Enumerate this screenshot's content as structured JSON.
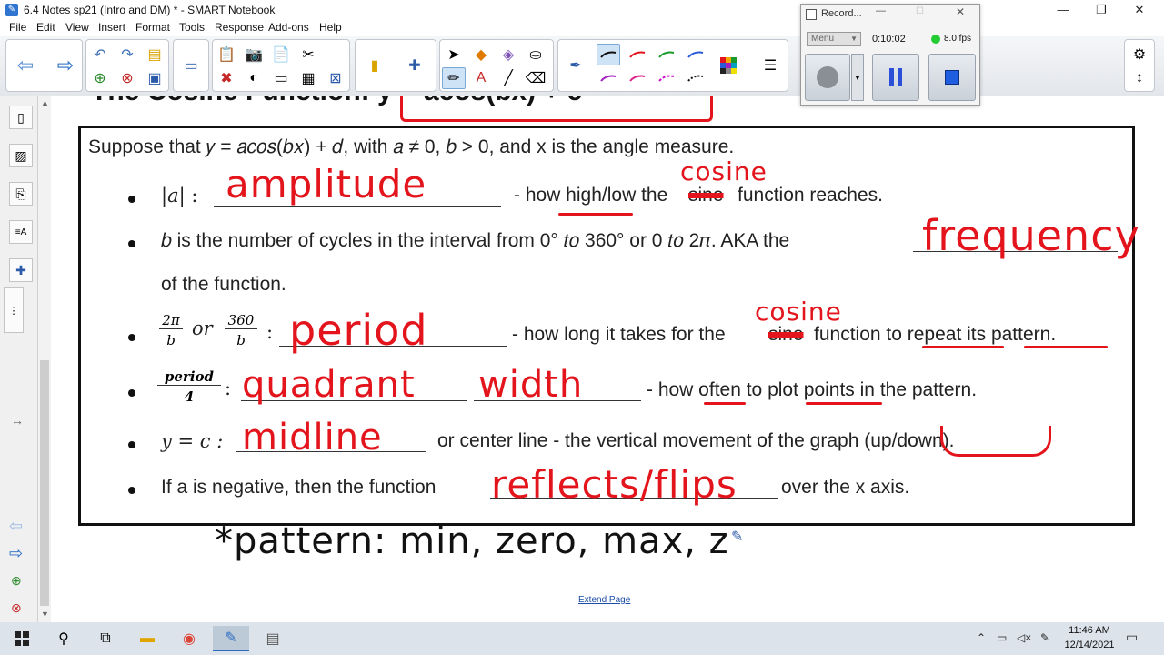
{
  "window": {
    "title": "6.4 Notes sp21 (Intro and DM) * - SMART Notebook",
    "minimize": "—",
    "maximize": "❐",
    "close": "✕"
  },
  "menu": [
    "File",
    "Edit",
    "View",
    "Insert",
    "Format",
    "Tools",
    "Response",
    "Add-ons",
    "Help"
  ],
  "recorder": {
    "title": "Record...",
    "menu_label": "Menu",
    "elapsed": "0:10:02",
    "fps": "8.0 fps"
  },
  "notes": {
    "heading_partial": "The Cosine Function: y = acos(bx) + c",
    "intro": "Suppose that 𝑦 = 𝑎𝑐𝑜𝑠(𝑏𝑥) + 𝑑, with 𝑎 ≠ 0, 𝑏 > 0, and x is the angle measure.",
    "b1_label": "|𝑎| :",
    "b1_text": "- how high/low the",
    "b1_strike": "sine",
    "b1_tail": "function reaches.",
    "b2_text": "𝑏 is the number of cycles in the interval from 0° 𝑡𝑜 360° or 0 𝑡𝑜 2𝜋. AKA the",
    "b2_cont": "of the function.",
    "b3_or": "or",
    "b3_colon": ":",
    "b3_text": "- how long it takes for the",
    "b3_strike": "sine",
    "b3_tail": "function to repeat its pattern.",
    "b4_colon": ":",
    "b4_text": "- how often to plot points in the pattern.",
    "b5_label": "𝑦 = 𝑐 :",
    "b5_text": "or center line - the vertical movement of the graph (up/down).",
    "b6_text": "If a is negative, then the function",
    "b6_tail": "over the x axis.",
    "frac_2pi_num": "2π",
    "frac_2pi_den": "b",
    "frac_360_num": "360",
    "frac_360_den": "b",
    "frac_period_num": "period",
    "frac_period_den": "4"
  },
  "handwriting": {
    "cosine_1": "cosine",
    "amplitude": "amplitude",
    "frequency": "frequency",
    "cosine_2": "cosine",
    "period": "period",
    "quadrant": "quadrant",
    "width": "width",
    "midline": "midline",
    "reflects": "reflects/flips",
    "pattern": "*pattern: min, zero, max, z"
  },
  "extend_page": "Extend Page",
  "taskbar": {
    "time": "11:46 AM",
    "date": "12/14/2021"
  },
  "colors": {
    "ink_red": "#e3141c",
    "ink_black": "#111111",
    "taskbar": "#dce3ea"
  }
}
